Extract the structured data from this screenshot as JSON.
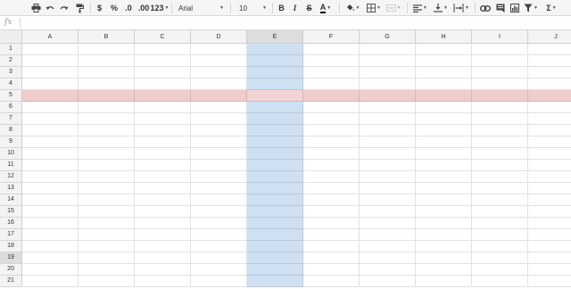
{
  "toolbar": {
    "items": [
      {
        "name": "print-button",
        "kind": "icon",
        "icon": "printer-icon",
        "interactable": true
      },
      {
        "name": "undo-button",
        "kind": "icon",
        "icon": "undo-icon",
        "interactable": true
      },
      {
        "name": "redo-button",
        "kind": "icon",
        "icon": "redo-icon",
        "interactable": true
      },
      {
        "name": "paint-format-button",
        "kind": "icon",
        "icon": "paint-format-icon",
        "interactable": true
      },
      {
        "name": "currency-format-button",
        "kind": "text",
        "label": "$",
        "interactable": true
      },
      {
        "name": "percent-format-button",
        "kind": "text",
        "label": "%",
        "interactable": true
      },
      {
        "name": "decrease-decimal-button",
        "kind": "text",
        "label": ".0",
        "interactable": true
      },
      {
        "name": "increase-decimal-button",
        "kind": "text",
        "label": ".00",
        "interactable": true
      },
      {
        "name": "more-formats-dropdown",
        "kind": "text",
        "label": "123",
        "interactable": true
      },
      {
        "name": "font-family-dropdown",
        "kind": "text",
        "label": "Arial",
        "interactable": true
      },
      {
        "name": "font-size-dropdown",
        "kind": "text",
        "label": "10",
        "interactable": true
      },
      {
        "name": "bold-button",
        "kind": "text",
        "label": "B",
        "interactable": true
      },
      {
        "name": "italic-button",
        "kind": "text",
        "label": "I",
        "interactable": true
      },
      {
        "name": "strikethrough-button",
        "kind": "text",
        "label": "S",
        "interactable": true
      },
      {
        "name": "text-color-button",
        "kind": "text",
        "label": "A",
        "interactable": true
      },
      {
        "name": "fill-color-button",
        "kind": "icon",
        "icon": "fill-color-icon",
        "interactable": true
      },
      {
        "name": "borders-button",
        "kind": "icon",
        "icon": "borders-icon",
        "interactable": true
      },
      {
        "name": "merge-cells-button",
        "kind": "icon",
        "icon": "merge-cells-icon",
        "interactable": true
      },
      {
        "name": "horizontal-align-button",
        "kind": "icon",
        "icon": "align-left-icon",
        "interactable": true
      },
      {
        "name": "vertical-align-button",
        "kind": "icon",
        "icon": "vertical-align-bottom-icon",
        "interactable": true
      },
      {
        "name": "text-wrap-button",
        "kind": "icon",
        "icon": "text-wrap-icon",
        "interactable": true
      },
      {
        "name": "insert-link-button",
        "kind": "icon",
        "icon": "link-icon",
        "interactable": true
      },
      {
        "name": "insert-comment-button",
        "kind": "icon",
        "icon": "comment-icon",
        "interactable": true
      },
      {
        "name": "insert-chart-button",
        "kind": "icon",
        "icon": "chart-icon",
        "interactable": true
      },
      {
        "name": "filter-button",
        "kind": "icon",
        "icon": "filter-icon",
        "interactable": true
      },
      {
        "name": "functions-button",
        "kind": "text",
        "label": "Σ",
        "interactable": true
      }
    ]
  },
  "formula_bar": {
    "label": "fx",
    "value": ""
  },
  "colors": {
    "selected_column_fill": "#cfe0f2",
    "selected_row_fill": "#f1cccc",
    "header_fill": "#f3f3f3",
    "header_selected_fill": "#dddddd",
    "gridline": "#e2e2e2"
  },
  "sheet": {
    "columns": [
      "A",
      "B",
      "C",
      "D",
      "E",
      "F",
      "G",
      "H",
      "I",
      "J"
    ],
    "rows": [
      "1",
      "2",
      "3",
      "4",
      "5",
      "6",
      "7",
      "8",
      "9",
      "10",
      "11",
      "12",
      "13",
      "14",
      "15",
      "16",
      "17",
      "18",
      "19",
      "20",
      "21"
    ],
    "selected_column": "E",
    "selected_row": "5",
    "selected_row_header": "19"
  }
}
